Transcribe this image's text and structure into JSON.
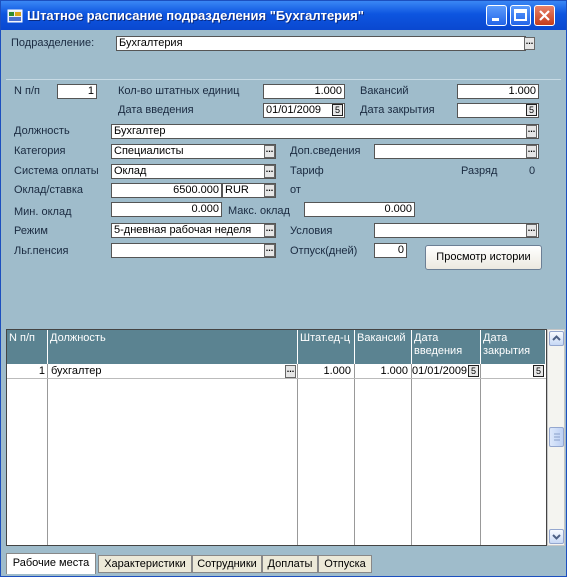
{
  "window": {
    "title": "Штатное расписание подразделения \"Бухгалтерия\"",
    "icon": "app-icon"
  },
  "header": {
    "dept_label": "Подразделение:",
    "dept_value": "Бухгалтерия"
  },
  "form": {
    "npp_label": "N п/п",
    "npp_value": "1",
    "units_label": "Кол-во штатных единиц",
    "units_value": "1.000",
    "vac_label": "Вакансий",
    "vac_value": "1.000",
    "date_in_label": "Дата введения",
    "date_in_value": "01/01/2009",
    "date_close_label": "Дата закрытия",
    "date_close_value": "",
    "position_label": "Должность",
    "position_value": "Бухгалтер",
    "category_label": "Категория",
    "category_value": "Специалисты",
    "extra_label": "Доп.сведения",
    "extra_value": "",
    "paysys_label": "Система оплаты",
    "paysys_value": "Оклад",
    "tariff_label": "Тариф",
    "grade_label": "Разряд",
    "grade_value": "0",
    "salary_label": "Оклад/ставка",
    "salary_value": "6500.000",
    "currency_value": "RUR",
    "from_label": "от",
    "minsal_label": "Мин. оклад",
    "minsal_value": "0.000",
    "maxsal_label": "Макс. оклад",
    "maxsal_value": "0.000",
    "mode_label": "Режим",
    "mode_value": "5-дневная рабочая неделя",
    "cond_label": "Условия",
    "cond_value": "",
    "pension_label": "Льг.пенсия",
    "pension_value": "",
    "vacation_label": "Отпуск(дней)",
    "vacation_value": "0",
    "history_button": "Просмотр истории"
  },
  "grid": {
    "headers": [
      "N п/п",
      "Должность",
      "Штат.ед-ц",
      "Вакансий",
      "Дата введения",
      "Дата закрытия"
    ],
    "rows": [
      [
        "1",
        "бухгалтер",
        "1.000",
        "1.000",
        "01/01/2009",
        ""
      ]
    ]
  },
  "tabs": [
    "Рабочие места",
    "Характеристики",
    "Сотрудники",
    "Доплаты",
    "Отпуска"
  ],
  "active_tab": 0
}
